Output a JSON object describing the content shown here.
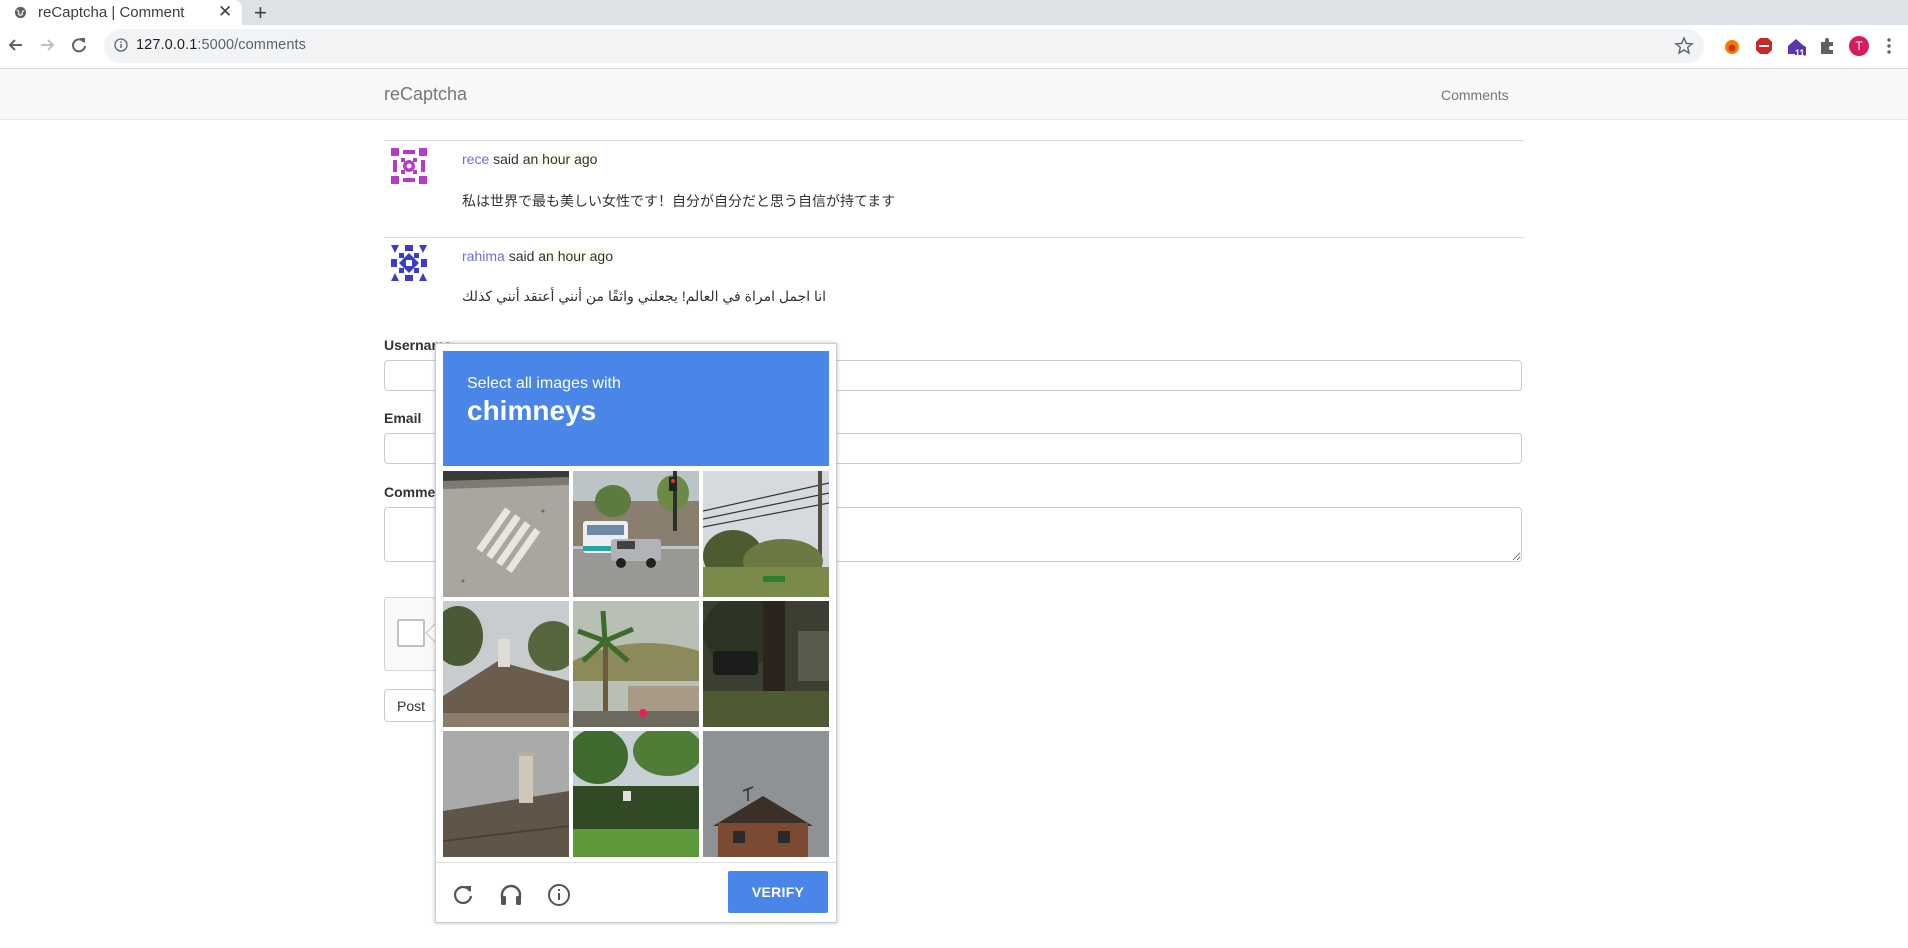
{
  "browser": {
    "tab_title": "reCaptcha | Comment",
    "tab_close": "✕",
    "new_tab": "+",
    "url_host": "127.0.0.1",
    "url_path": ":5000/comments",
    "profile_initial": "T",
    "extension_badge": "11"
  },
  "navbar": {
    "brand": "reCaptcha",
    "link": "Comments"
  },
  "comments": [
    {
      "user": "rece",
      "said": "said",
      "time": "an hour ago",
      "text": "私は世界で最も美しい女性です！自分が自分だと思う自信が持てます",
      "avatar_color": "#b43cc8"
    },
    {
      "user": "rahima",
      "said": "said",
      "time": "an hour ago",
      "text": "انا اجمل امراة في العالم! يجعلني واثقًا من أنني أعتقد أنني كذلك",
      "avatar_color": "#3c3cc8"
    }
  ],
  "form": {
    "username_label": "Username",
    "email_label": "Email",
    "comment_label": "Comment",
    "post_button": "Post"
  },
  "captcha": {
    "instruction": "Select all images with",
    "target": "chimneys",
    "verify_label": "VERIFY",
    "header_color": "#4a86e8",
    "tiles": [
      "crosswalk road",
      "street with truck and bus",
      "power lines and trees",
      "house roof with chimney",
      "palm tree by building",
      "dark tree and car",
      "roof with chimney",
      "green fence and trees",
      "house under grey sky"
    ],
    "icons": [
      "reload-icon",
      "audio-icon",
      "info-icon"
    ]
  }
}
